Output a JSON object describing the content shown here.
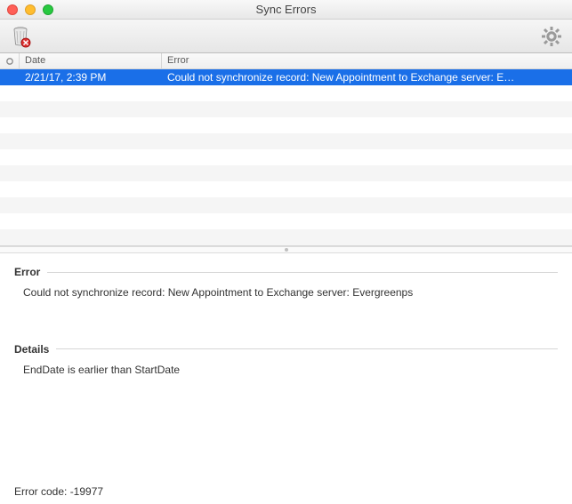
{
  "window": {
    "title": "Sync Errors"
  },
  "columns": {
    "indicator": "",
    "date": "Date",
    "error": "Error"
  },
  "rows": [
    {
      "date": "2/21/17, 2:39 PM",
      "error": "Could not synchronize record: New Appointment to Exchange server: E…"
    }
  ],
  "pane": {
    "error_label": "Error",
    "error_text": "Could not synchronize record: New Appointment to Exchange server: Evergreenps",
    "details_label": "Details",
    "details_text": "EndDate is earlier than StartDate",
    "error_code": "Error code: -19977"
  }
}
